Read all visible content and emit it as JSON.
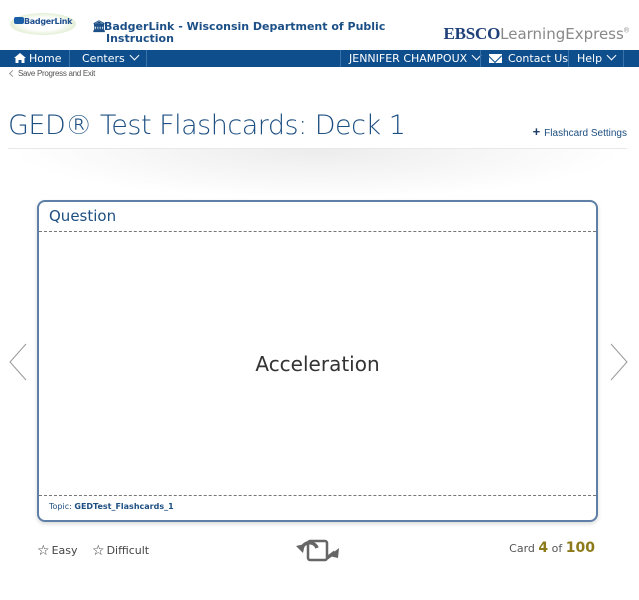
{
  "header": {
    "badgerlink_logo_text": "BadgerLink",
    "institution_line1": "BadgerLink - Wisconsin Department of Public",
    "institution_line2": "Instruction",
    "ebsco_brand": "EBSCO",
    "product_name": "LearningExpress",
    "registered_mark": "®"
  },
  "nav": {
    "home": "Home",
    "centers": "Centers",
    "user": "JENNIFER CHAMPOUX",
    "contact": "Contact Us",
    "help": "Help"
  },
  "save_exit": "Save Progress and Exit",
  "page_title": "GED® Test Flashcards: Deck 1",
  "settings_link": "Flashcard Settings",
  "card": {
    "side_label": "Question",
    "term": "Acceleration",
    "topic_label": "Topic:",
    "topic_value": "GEDTest_Flashcards_1"
  },
  "controls": {
    "easy": "Easy",
    "difficult": "Difficult",
    "card_label": "Card",
    "current": "4",
    "of_label": "of",
    "total": "100"
  },
  "colors": {
    "nav_bg": "#0e4e8c",
    "title_blue": "#1d4f82",
    "card_border": "#5e7fa6",
    "counter_gold": "#8c7a1a"
  }
}
